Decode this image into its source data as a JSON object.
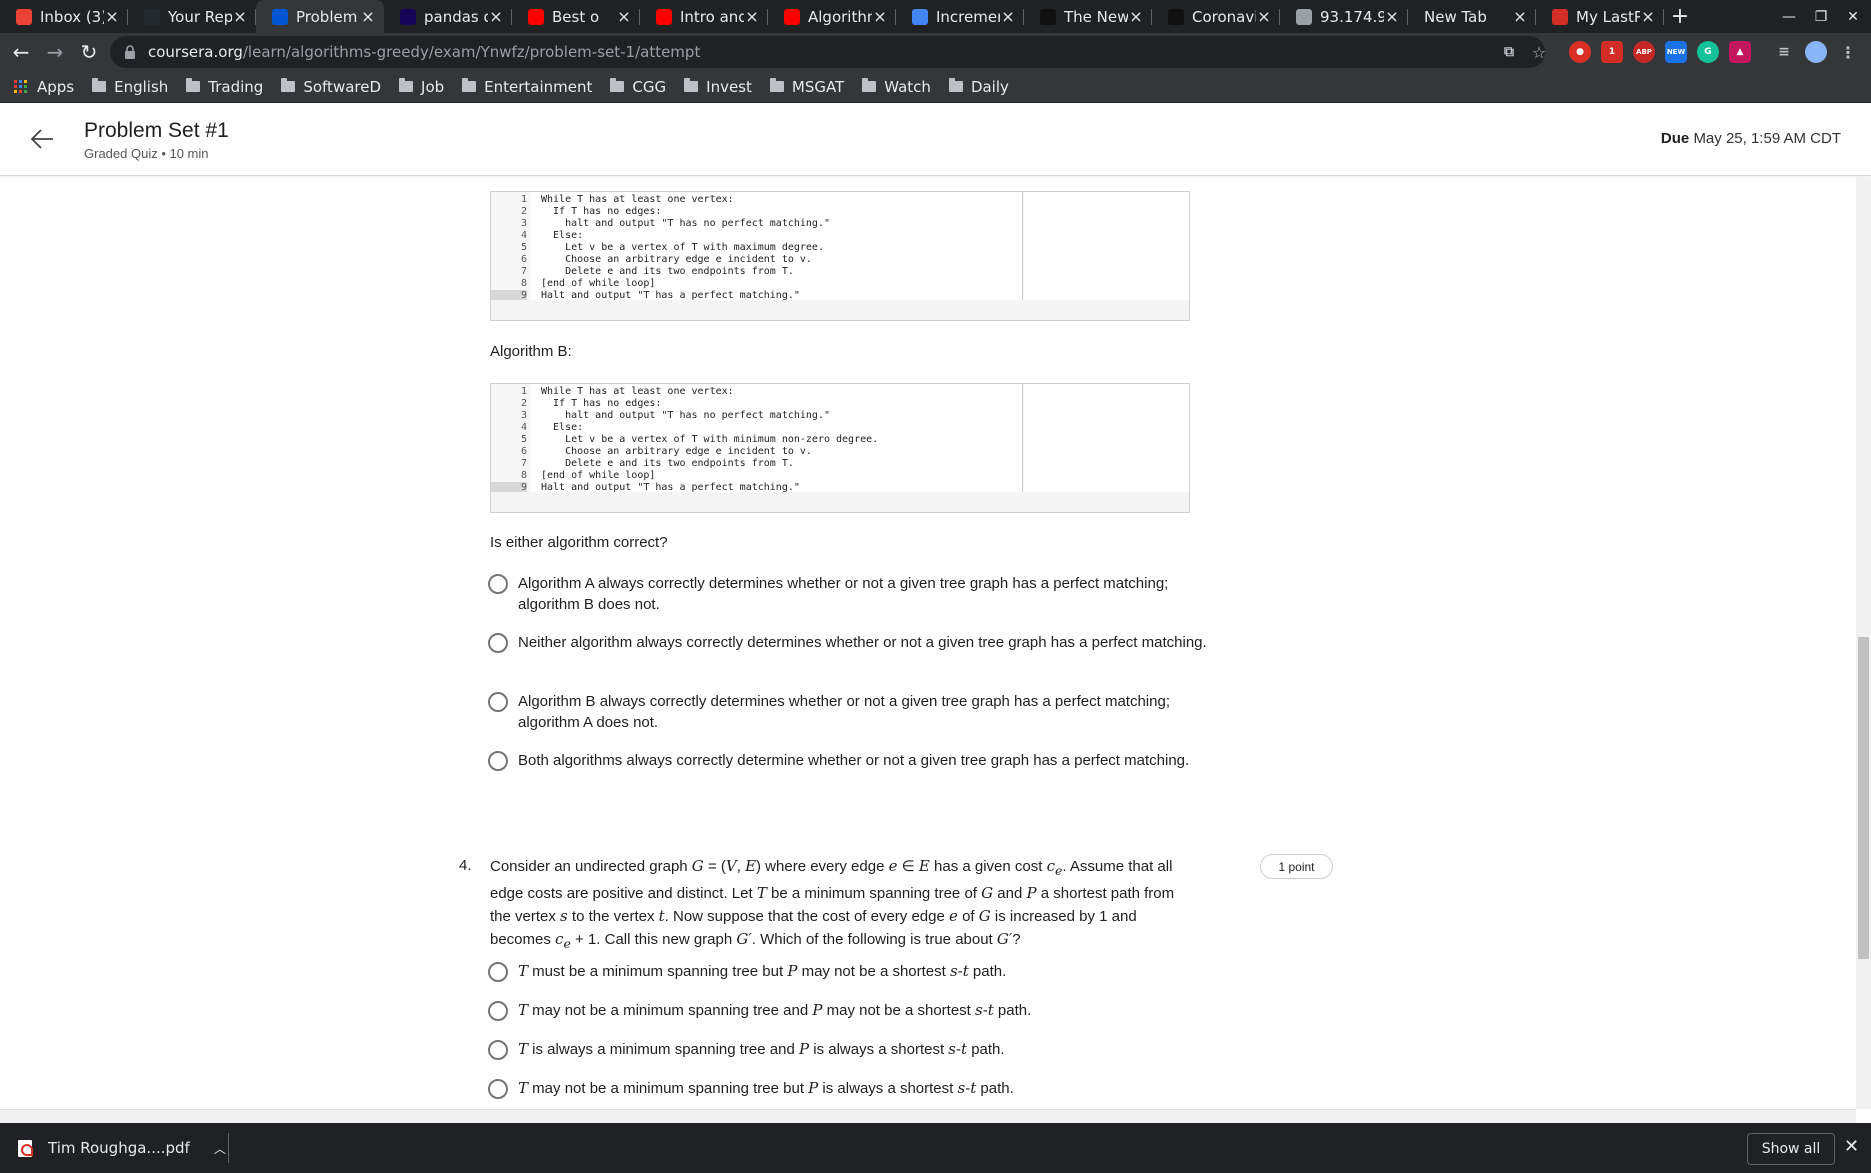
{
  "browser": {
    "tabs": [
      {
        "title": "Inbox (3)",
        "icon": "gmail-icon",
        "color": "#ea4335",
        "active": false
      },
      {
        "title": "Your Rep",
        "icon": "github-icon",
        "color": "#24292e",
        "active": false
      },
      {
        "title": "Problem",
        "icon": "coursera-icon",
        "color": "#0056d2",
        "active": true
      },
      {
        "title": "pandas d",
        "icon": "pandas-icon",
        "color": "#150458",
        "active": false
      },
      {
        "title": "Best o",
        "icon": "youtube-icon",
        "color": "#ff0000",
        "active": false
      },
      {
        "title": "Intro and",
        "icon": "youtube-icon",
        "color": "#ff0000",
        "active": false
      },
      {
        "title": "Algorithm",
        "icon": "youtube-icon",
        "color": "#ff0000",
        "active": false
      },
      {
        "title": "Incremen",
        "icon": "doc-icon",
        "color": "#4285f4",
        "active": false
      },
      {
        "title": "The New",
        "icon": "nyt-icon",
        "color": "#111111",
        "active": false
      },
      {
        "title": "Coronavi",
        "icon": "nyt-icon",
        "color": "#111111",
        "active": false
      },
      {
        "title": "93.174.95",
        "icon": "globe-icon",
        "color": "#9aa0a6",
        "active": false
      },
      {
        "title": "New Tab",
        "icon": "",
        "color": "#35363a",
        "active": false
      },
      {
        "title": "My LastP",
        "icon": "lastpass-icon",
        "color": "#d32d27",
        "active": false
      }
    ],
    "url_host": "coursera.org",
    "url_path": "/learn/algorithms-greedy/exam/Ynwfz/problem-set-1/attempt",
    "bookmarks": [
      "Apps",
      "English",
      "Trading",
      "SoftwareD",
      "Job",
      "Entertainment",
      "CGG",
      "Invest",
      "MSGAT",
      "Watch",
      "Daily"
    ],
    "ext_labels": {
      "abp": "ABP",
      "new": "NEW",
      "badge": "1"
    }
  },
  "header": {
    "title": "Problem Set #1",
    "subtitle": "Graded Quiz • 10 min",
    "due_label": "Due",
    "due_value": "May 25, 1:59 AM CDT"
  },
  "algorithm_a": {
    "lines": [
      {
        "n": "1",
        "code": "While T has at least one vertex:"
      },
      {
        "n": "2",
        "code": "  If T has no edges:"
      },
      {
        "n": "3",
        "code": "    halt and output \"T has no perfect matching.\""
      },
      {
        "n": "4",
        "code": "  Else:"
      },
      {
        "n": "5",
        "code": "    Let v be a vertex of T with maximum degree."
      },
      {
        "n": "6",
        "code": "    Choose an arbitrary edge e incident to v."
      },
      {
        "n": "7",
        "code": "    Delete e and its two endpoints from T."
      },
      {
        "n": "8",
        "code": "[end of while loop]"
      },
      {
        "n": "9",
        "code": "Halt and output \"T has a perfect matching.\""
      }
    ]
  },
  "algorithm_b": {
    "label": "Algorithm B:",
    "lines": [
      {
        "n": "1",
        "code": "While T has at least one vertex:"
      },
      {
        "n": "2",
        "code": "  If T has no edges:"
      },
      {
        "n": "3",
        "code": "    halt and output \"T has no perfect matching.\""
      },
      {
        "n": "4",
        "code": "  Else:"
      },
      {
        "n": "5",
        "code": "    Let v be a vertex of T with minimum non-zero degree."
      },
      {
        "n": "6",
        "code": "    Choose an arbitrary edge e incident to v."
      },
      {
        "n": "7",
        "code": "    Delete e and its two endpoints from T."
      },
      {
        "n": "8",
        "code": "[end of while loop]"
      },
      {
        "n": "9",
        "code": "Halt and output \"T has a perfect matching.\""
      }
    ]
  },
  "question3": {
    "prompt": "Is either algorithm correct?",
    "options": [
      "Algorithm A always correctly determines whether or not a given tree graph has a perfect matching; algorithm B does not.",
      "Neither algorithm always correctly determines whether or not a given tree graph has a perfect matching.",
      "Algorithm B always correctly determines whether or not a given tree graph has a perfect matching; algorithm A does not.",
      "Both algorithms always correctly determine whether or not a given tree graph has a perfect matching."
    ]
  },
  "question4": {
    "number": "4.",
    "points": "1 point",
    "prompt_html": "Consider an undirected graph <span class=\"math\">G</span> = (<span class=\"math\">V</span>, <span class=\"math\">E</span>) where every edge <span class=\"math\">e</span> ∈ <span class=\"math\">E</span> has a given cost <span class=\"math\">c<sub>e</sub></span>. Assume that all edge costs are positive and distinct. Let <span class=\"math\">T</span> be a minimum spanning tree of <span class=\"math\">G</span> and <span class=\"math\">P</span> a shortest path from the vertex <span class=\"math\">s</span> to the vertex <span class=\"math\">t</span>. Now suppose that the cost of every edge <span class=\"math\">e</span> of <span class=\"math\">G</span> is increased by 1 and becomes <span class=\"math\">c<sub>e</sub></span> + 1. Call this new graph <span class=\"math\">G′</span>. Which of the following is true about <span class=\"math\">G′</span>?",
    "options_html": [
      "<span class=\"math\">T</span> must be a minimum spanning tree but <span class=\"math\">P</span> may not be a shortest <span class=\"math\">s</span>-<span class=\"math\">t</span> path.",
      "<span class=\"math\">T</span> may not be a minimum spanning tree and <span class=\"math\">P</span> may not be a shortest <span class=\"math\">s</span>-<span class=\"math\">t</span> path.",
      "<span class=\"math\">T</span> is always a minimum spanning tree and <span class=\"math\">P</span> is always a shortest <span class=\"math\">s</span>-<span class=\"math\">t</span> path.",
      "<span class=\"math\">T</span> may not be a minimum spanning tree but <span class=\"math\">P</span> is always a shortest <span class=\"math\">s</span>-<span class=\"math\">t</span> path."
    ]
  },
  "downloads": {
    "file": "Tim Roughga....pdf",
    "show_all": "Show all"
  }
}
